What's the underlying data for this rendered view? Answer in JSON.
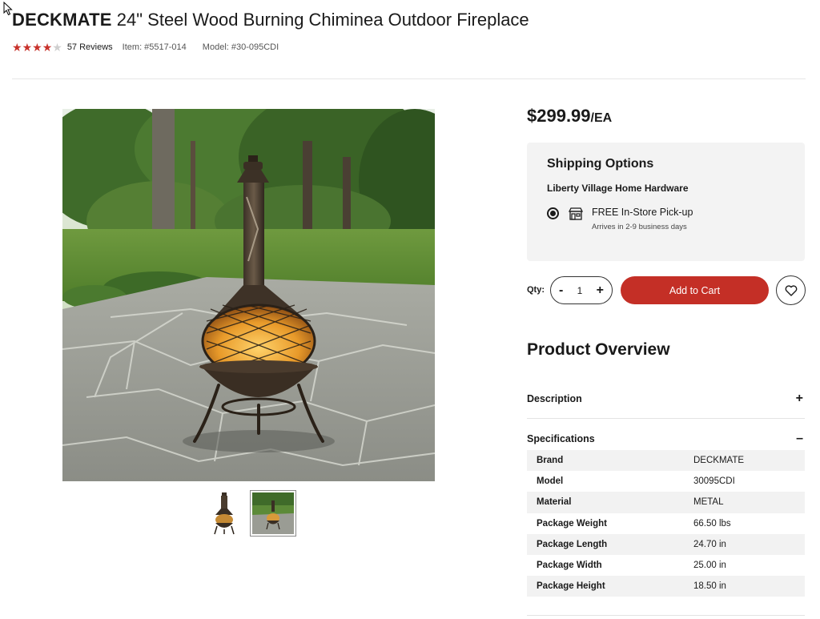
{
  "product": {
    "brand": "DECKMATE",
    "name": "24\" Steel Wood Burning Chiminea Outdoor Fireplace",
    "rating": 4,
    "rating_max": 5,
    "reviews_label": "57 Reviews",
    "item_label": "Item: #5517-014",
    "model_label": "Model: #30-095CDI"
  },
  "pricing": {
    "price": "$299.99",
    "unit": "/EA"
  },
  "shipping": {
    "title": "Shipping Options",
    "store": "Liberty Village Home Hardware",
    "method": "FREE In-Store Pick-up",
    "eta": "Arrives in 2-9 business days",
    "selected": true,
    "icon": "store-icon"
  },
  "cart": {
    "qty_label": "Qty:",
    "qty_value": "1",
    "minus": "-",
    "plus": "+",
    "add_to_cart": "Add to Cart",
    "wishlist_icon": "heart-icon"
  },
  "overview": {
    "title": "Product Overview",
    "description_label": "Description",
    "description_sign": "+",
    "specifications_label": "Specifications",
    "specifications_sign": "–"
  },
  "specs": [
    {
      "key": "Brand",
      "value": "DECKMATE"
    },
    {
      "key": "Model",
      "value": "30095CDI"
    },
    {
      "key": "Material",
      "value": "METAL"
    },
    {
      "key": "Package Weight",
      "value": "66.50 lbs"
    },
    {
      "key": "Package Length",
      "value": "24.70 in"
    },
    {
      "key": "Package Width",
      "value": "25.00 in"
    },
    {
      "key": "Package Height",
      "value": "18.50 in"
    }
  ],
  "gallery": {
    "thumbnails": 2,
    "active_index": 1
  },
  "colors": {
    "accent": "#c42f26",
    "star": "#c8322b",
    "panel_bg": "#f3f3f3"
  }
}
